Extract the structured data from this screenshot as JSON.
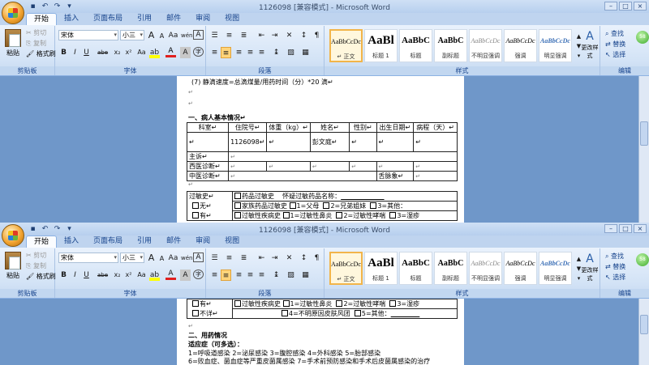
{
  "window": {
    "title": "1126098 [兼容模式] - Microsoft Word",
    "qat_icons": [
      "save-icon",
      "undo-icon",
      "redo-icon",
      "customize-icon"
    ],
    "controls": [
      "–",
      "□",
      "×"
    ]
  },
  "tabs": [
    "开始",
    "插入",
    "页面布局",
    "引用",
    "邮件",
    "审阅",
    "视图"
  ],
  "clipboard": {
    "paste": "粘贴",
    "cut": "剪切",
    "copy": "复制",
    "format_painter": "格式刷",
    "label": "剪贴板"
  },
  "font": {
    "name": "宋体",
    "size": "小三",
    "grow": "A",
    "shrink": "A",
    "aa": "Aa",
    "wen": "wén",
    "bold": "B",
    "italic": "I",
    "underline": "U",
    "strike": "abe",
    "sub": "x₂",
    "sup": "x²",
    "clear": "Aa",
    "label": "字体"
  },
  "paragraph": {
    "label": "段落"
  },
  "styles": {
    "items": [
      {
        "preview": "AaBbCcDc",
        "name": "↵ 正文"
      },
      {
        "preview": "AaBl",
        "name": "标题 1"
      },
      {
        "preview": "AaBbC",
        "name": "标题"
      },
      {
        "preview": "AaBbC",
        "name": "副标题"
      },
      {
        "preview": "AaBbCcDc",
        "name": "不明显强调"
      },
      {
        "preview": "AaBbCcDc",
        "name": "强调"
      },
      {
        "preview": "AaBbCcDc",
        "name": "明显强调"
      }
    ],
    "change": "更改样式",
    "label": "样式"
  },
  "editing": {
    "find": "查找",
    "replace": "替换",
    "select": "选择",
    "label": "编辑"
  },
  "badge": "58",
  "doc_top": {
    "line1": "(7) 静滴速度=总滴煤量/用药时间（分）*20 滴↵",
    "section1": "一、病人基本情况↵",
    "headers": [
      "科室↵",
      "住院号↵",
      "体重（kg）↵",
      "姓名↵",
      "性别↵",
      "出生日期↵",
      "病程（天）↵"
    ],
    "row1": [
      "↵",
      "1126098↵",
      "↵",
      "彭文庭↵",
      "↵",
      "↵",
      "↵"
    ],
    "zhusu": "主诉↵",
    "xiyi": "西医诊断↵",
    "zhongyi": "中医诊断↵",
    "zhongyi_extra": "舌脉象↵",
    "allergy_label": "过敏史↵",
    "allergy_no": "无↵",
    "allergy_yes": "有↵",
    "drug_allergy": "药品过敏史",
    "suspect": "怀疑过敏药品名称：",
    "family_allergy": "家族药品过敏史",
    "father_mother": "1=父母",
    "siblings": "2=兄弟姐妹",
    "other": "3=其他：",
    "allergic_disease": "过敏性疾病史",
    "rhinitis": "1=过敏性鼻炎",
    "asthma": "2=过敏性哮喘",
    "eczema": "3=湿疹"
  },
  "doc_bottom": {
    "have": "有↵",
    "unknown": "不详↵",
    "allergic_disease": "过敏性疾病史",
    "rhinitis": "1=过敏性鼻炎",
    "asthma": "2=过敏性哮喘",
    "eczema": "3=湿疹",
    "urticaria": "4=不明原因皮肤风团",
    "other5": "5=其他：",
    "section2": "二、用药情况",
    "indication": "适应症（可多选）：",
    "list1": "1=呼吸道感染   2=泌尿感染   3=腹腔感染   4=外科感染   5=胎部感染",
    "list2": "6=败血症、菌血症等严重皮菌属感染 7=手术前预防感染和手术后皮菌属感染的治疗"
  }
}
